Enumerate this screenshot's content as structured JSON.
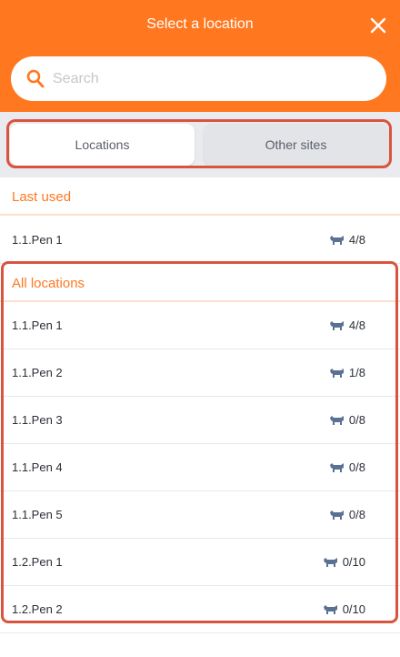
{
  "header": {
    "title": "Select a location",
    "close_icon": "close-icon",
    "background_color": "#ff7820"
  },
  "search": {
    "placeholder": "Search",
    "value": "",
    "icon": "search-icon"
  },
  "tabs": [
    {
      "label": "Locations",
      "active": true
    },
    {
      "label": "Other sites",
      "active": false
    }
  ],
  "last_used": {
    "title": "Last used",
    "items": [
      {
        "name": "1.1.Pen 1",
        "count": "4/8"
      }
    ]
  },
  "all_locations": {
    "title": "All locations",
    "items": [
      {
        "name": "1.1.Pen 1",
        "count": "4/8"
      },
      {
        "name": "1.1.Pen 2",
        "count": "1/8"
      },
      {
        "name": "1.1.Pen 3",
        "count": "0/8"
      },
      {
        "name": "1.1.Pen 4",
        "count": "0/8"
      },
      {
        "name": "1.1.Pen 5",
        "count": "0/8"
      },
      {
        "name": "1.2.Pen 1",
        "count": "0/10"
      },
      {
        "name": "1.2.Pen 2",
        "count": "0/10"
      }
    ]
  },
  "colors": {
    "accent": "#ff7820",
    "highlight_outline": "#d9543f",
    "animal_icon": "#5b7194"
  },
  "count_icon": "animal-icon"
}
